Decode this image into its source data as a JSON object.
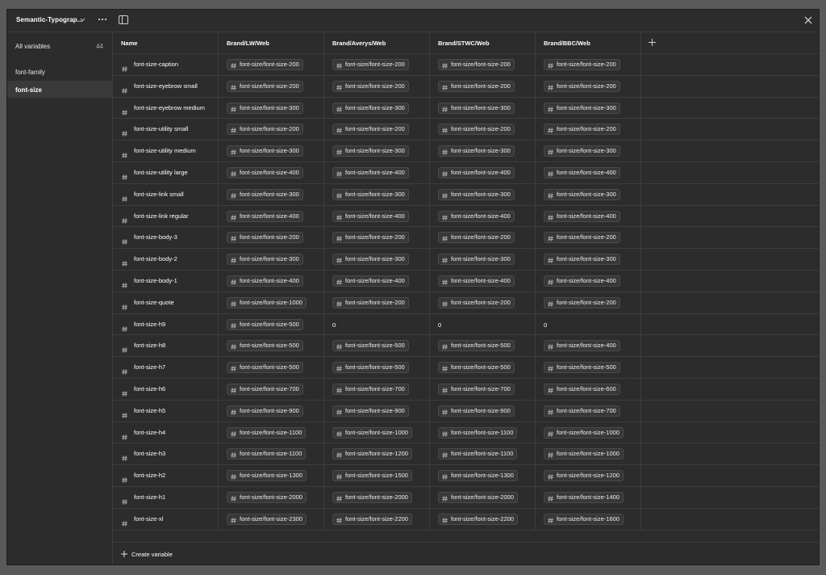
{
  "collection": {
    "title": "Semantic-Typograp...",
    "menu_icon": "ellipsis-icon"
  },
  "sidebar": {
    "groups": [
      {
        "label": "All variables",
        "count": "44"
      },
      {
        "label": "font-family",
        "count": ""
      },
      {
        "label": "font-size",
        "count": "",
        "active": true
      }
    ]
  },
  "table": {
    "columns": [
      "Name",
      "Brand/LW/Web",
      "Brand/Averys/Web",
      "Brand/STWC/Web",
      "Brand/BBC/Web"
    ],
    "rows": [
      {
        "name": "font-size-caption",
        "values": [
          "font-size/font-size-200",
          "font-size/font-size-200",
          "font-size/font-size-200",
          "font-size/font-size-200"
        ]
      },
      {
        "name": "font-size-eyebrow small",
        "values": [
          "font-size/font-size-200",
          "font-size/font-size-200",
          "font-size/font-size-200",
          "font-size/font-size-200"
        ]
      },
      {
        "name": "font-size-eyebrow medium",
        "values": [
          "font-size/font-size-300",
          "font-size/font-size-300",
          "font-size/font-size-300",
          "font-size/font-size-300"
        ]
      },
      {
        "name": "font-size-utility small",
        "values": [
          "font-size/font-size-200",
          "font-size/font-size-200",
          "font-size/font-size-200",
          "font-size/font-size-200"
        ]
      },
      {
        "name": "font-size-utility medium",
        "values": [
          "font-size/font-size-300",
          "font-size/font-size-300",
          "font-size/font-size-300",
          "font-size/font-size-300"
        ]
      },
      {
        "name": "font-size-utility large",
        "values": [
          "font-size/font-size-400",
          "font-size/font-size-400",
          "font-size/font-size-400",
          "font-size/font-size-400"
        ]
      },
      {
        "name": "font-size-link small",
        "values": [
          "font-size/font-size-300",
          "font-size/font-size-300",
          "font-size/font-size-300",
          "font-size/font-size-300"
        ]
      },
      {
        "name": "font-size-link regular",
        "values": [
          "font-size/font-size-400",
          "font-size/font-size-400",
          "font-size/font-size-400",
          "font-size/font-size-400"
        ]
      },
      {
        "name": "font-size-body-3",
        "values": [
          "font-size/font-size-200",
          "font-size/font-size-200",
          "font-size/font-size-200",
          "font-size/font-size-200"
        ]
      },
      {
        "name": "font-size-body-2",
        "values": [
          "font-size/font-size-300",
          "font-size/font-size-300",
          "font-size/font-size-300",
          "font-size/font-size-300"
        ]
      },
      {
        "name": "font-size-body-1",
        "values": [
          "font-size/font-size-400",
          "font-size/font-size-400",
          "font-size/font-size-400",
          "font-size/font-size-400"
        ]
      },
      {
        "name": "font-size-quote",
        "values": [
          "font-size/font-size-1000",
          "font-size/font-size-200",
          "font-size/font-size-200",
          "font-size/font-size-200"
        ]
      },
      {
        "name": "font-size-h9",
        "values": [
          "font-size/font-size-500",
          "0",
          "0",
          "0"
        ]
      },
      {
        "name": "font-size-h8",
        "values": [
          "font-size/font-size-500",
          "font-size/font-size-500",
          "font-size/font-size-500",
          "font-size/font-size-400"
        ]
      },
      {
        "name": "font-size-h7",
        "values": [
          "font-size/font-size-500",
          "font-size/font-size-500",
          "font-size/font-size-500",
          "font-size/font-size-500"
        ]
      },
      {
        "name": "font-size-h6",
        "values": [
          "font-size/font-size-700",
          "font-size/font-size-700",
          "font-size/font-size-700",
          "font-size/font-size-600"
        ]
      },
      {
        "name": "font-size-h5",
        "values": [
          "font-size/font-size-900",
          "font-size/font-size-900",
          "font-size/font-size-900",
          "font-size/font-size-700"
        ]
      },
      {
        "name": "font-size-h4",
        "values": [
          "font-size/font-size-1100",
          "font-size/font-size-1000",
          "font-size/font-size-1100",
          "font-size/font-size-1000"
        ]
      },
      {
        "name": "font-size-h3",
        "values": [
          "font-size/font-size-1100",
          "font-size/font-size-1200",
          "font-size/font-size-1100",
          "font-size/font-size-1000"
        ]
      },
      {
        "name": "font-size-h2",
        "values": [
          "font-size/font-size-1300",
          "font-size/font-size-1500",
          "font-size/font-size-1300",
          "font-size/font-size-1200"
        ]
      },
      {
        "name": "font-size-h1",
        "values": [
          "font-size/font-size-2000",
          "font-size/font-size-2000",
          "font-size/font-size-2000",
          "font-size/font-size-1400"
        ]
      },
      {
        "name": "font-size-xl",
        "values": [
          "font-size/font-size-2300",
          "font-size/font-size-2200",
          "font-size/font-size-2200",
          "font-size/font-size-1600"
        ]
      }
    ]
  },
  "footer": {
    "create_label": "Create variable"
  },
  "colors": {
    "background": "#2c2c2c",
    "border": "#3d3d3d",
    "pill": "#383838",
    "text": "#ffffff"
  }
}
